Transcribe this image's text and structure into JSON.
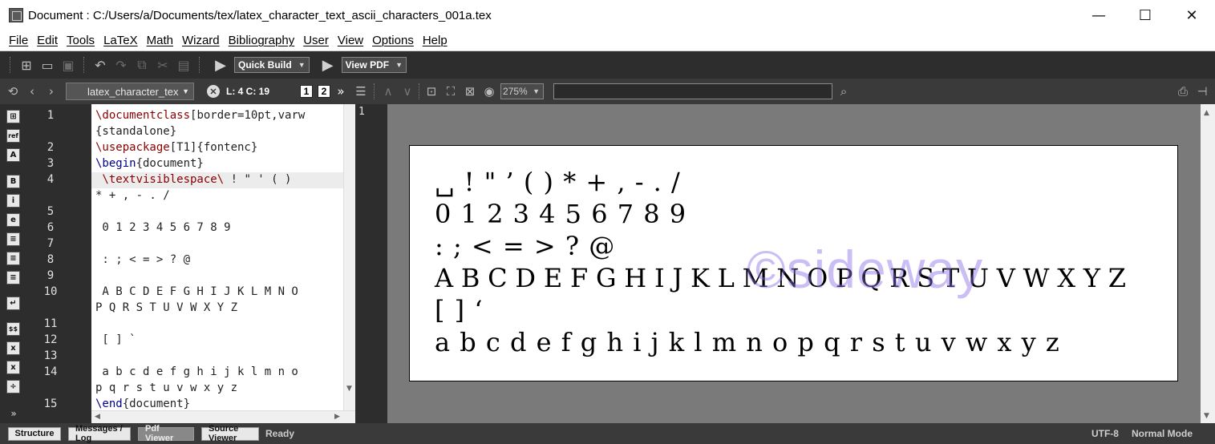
{
  "window": {
    "title": "Document : C:/Users/a/Documents/tex/latex_character_text_ascii_characters_001a.tex",
    "minimize": "—",
    "maximize": "☐",
    "close": "✕"
  },
  "menu": [
    "File",
    "Edit",
    "Tools",
    "LaTeX",
    "Math",
    "Wizard",
    "Bibliography",
    "User",
    "View",
    "Options",
    "Help"
  ],
  "toolbar": {
    "build_label": "Quick Build",
    "view_label": "View PDF"
  },
  "nav": {
    "file_tab": "latex_character_tex",
    "cursor_position": "L: 4 C: 19",
    "page_btn_1": "1",
    "page_btn_2": "2",
    "zoom": "275%",
    "search_value": ""
  },
  "editor": {
    "line_numbers": [
      "1",
      "2",
      "3",
      "4",
      "5",
      "6",
      "7",
      "8",
      "9",
      "10",
      "11",
      "12",
      "13",
      "14",
      "15"
    ],
    "lines": [
      {
        "cmd": "\\documentclass",
        "rest": "[border=10pt,varw"
      },
      {
        "cmd": "",
        "rest": "{standalone}"
      },
      {
        "cmd": "\\usepackage",
        "rest": "[T1]{fontenc}"
      },
      {
        "cmd": "\\begin",
        "rest": "{document}"
      },
      {
        "cmd": " \\textvisiblespace\\",
        "rest": " ! \" ' ( )"
      },
      {
        "cmd": "",
        "rest": "* + , - . /"
      },
      {
        "cmd": "",
        "rest": " 0 1 2 3 4 5 6 7 8 9"
      },
      {
        "cmd": "",
        "rest": " : ; < = > ? @"
      },
      {
        "cmd": "",
        "rest": " A B C D E F G H I J K L M N O"
      },
      {
        "cmd": "",
        "rest": "P Q R S T U V W X Y Z"
      },
      {
        "cmd": "",
        "rest": " [ ] `"
      },
      {
        "cmd": "",
        "rest": " a b c d e f g h i j k l m n o"
      },
      {
        "cmd": "",
        "rest": "p q r s t u v w x y z"
      },
      {
        "cmd": "\\end",
        "rest": "{document}"
      }
    ]
  },
  "pdf": {
    "page_number": "1",
    "lines": [
      "␣ ! \" ’ ( ) * + , - . /",
      "0 1 2 3 4 5 6 7 8 9",
      ": ; < = > ? @",
      "A B C D E F G H I J K L M N O P Q R S T U V W X Y Z",
      "[ ] ‘",
      "a b c d e f g h i j k l m n o p q r s t u v w x y z"
    ],
    "watermark": "©sideway"
  },
  "status": {
    "tabs": [
      "Structure",
      "Messages / Log",
      "Pdf Viewer",
      "Source Viewer"
    ],
    "ready": "Ready",
    "encoding": "UTF-8",
    "mode": "Normal Mode"
  }
}
